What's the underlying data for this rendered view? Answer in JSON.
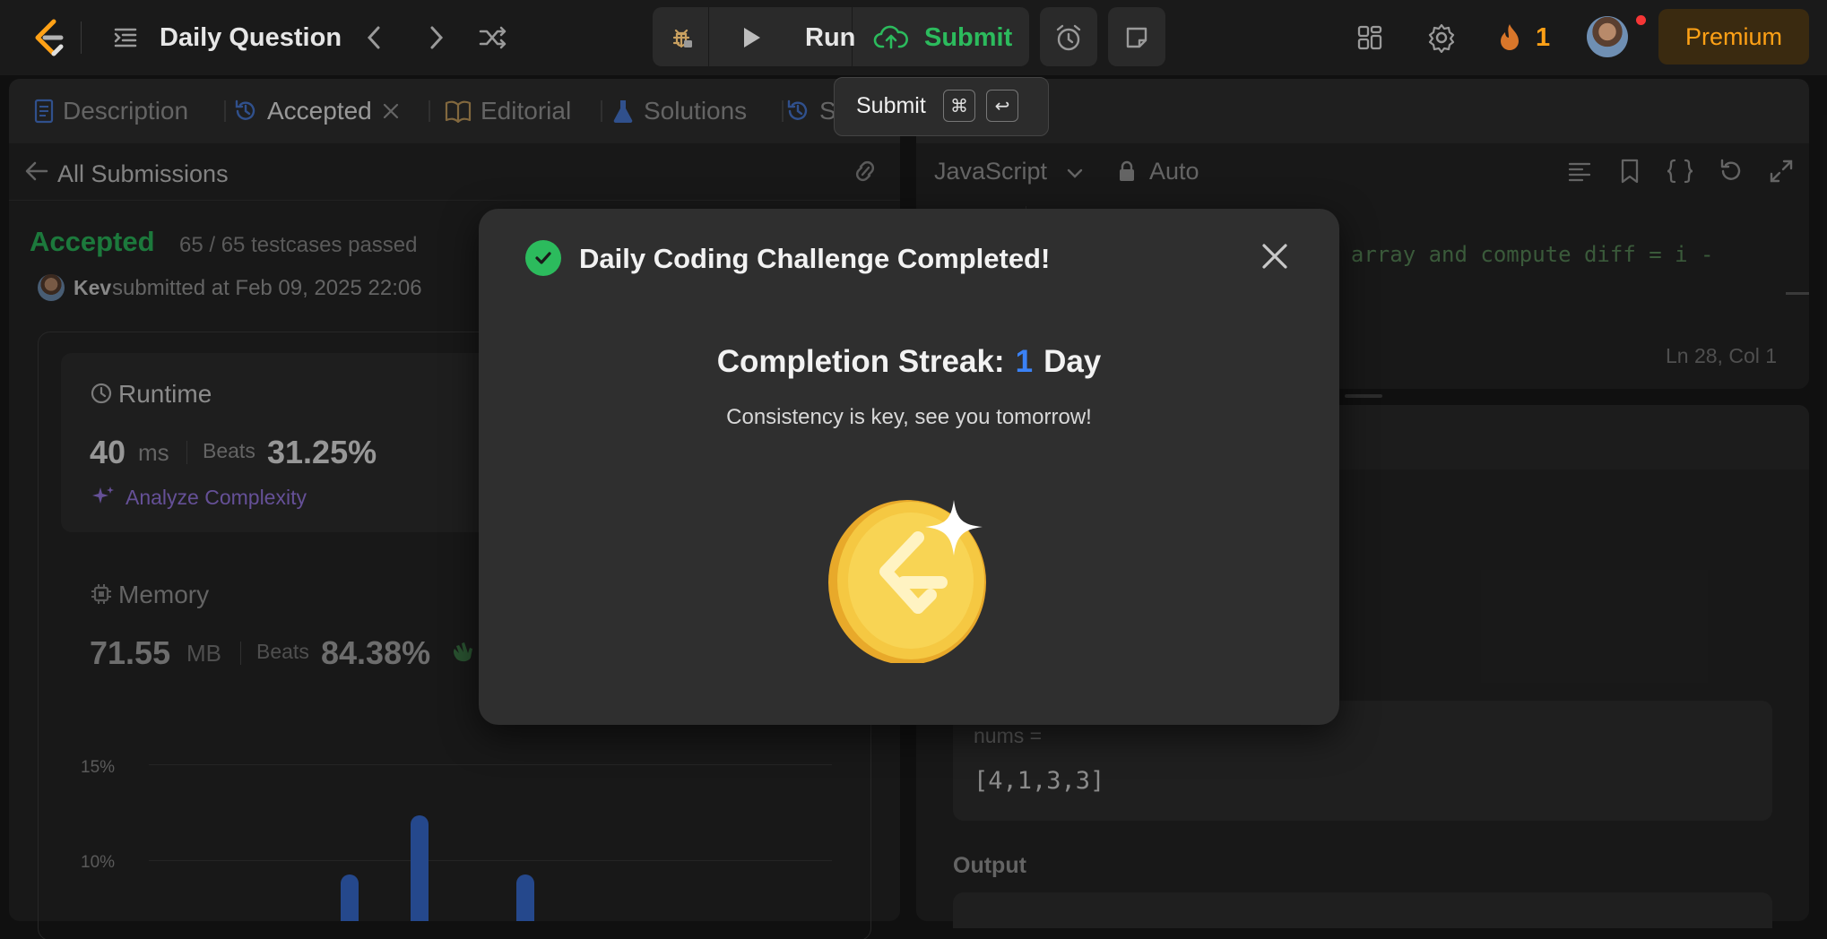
{
  "topbar": {
    "title": "Daily Question",
    "run_label": "Run",
    "submit_label": "Submit",
    "streak_count": "1",
    "premium_label": "Premium"
  },
  "tooltip": {
    "label": "Submit",
    "key1": "⌘",
    "key2": "↩"
  },
  "left_panel": {
    "tabs": [
      {
        "label": "Description"
      },
      {
        "label": "Accepted"
      },
      {
        "label": "Editorial"
      },
      {
        "label": "Solutions"
      },
      {
        "label": "S"
      }
    ],
    "back_label": "All Submissions",
    "status": "Accepted",
    "testcases": "65 / 65 testcases passed",
    "username": "Kev",
    "submitted": "submitted at Feb 09, 2025 22:06",
    "runtime": {
      "label": "Runtime",
      "value": "40",
      "unit": "ms",
      "beats_label": "Beats",
      "beats_value": "31.25%",
      "analyze_label": "Analyze Complexity"
    },
    "memory": {
      "label": "Memory",
      "value": "71.55",
      "unit": "MB",
      "beats_label": "Beats",
      "beats_value": "84.38%"
    },
    "chart_ticks": [
      "15%",
      "10%"
    ]
  },
  "editor": {
    "language": "JavaScript",
    "mode": "Auto",
    "code_line": "e array and compute diff = i -",
    "cursor": "Ln 28, Col 1"
  },
  "result": {
    "input_label": "nums =",
    "input_value": "[4,1,3,3]",
    "output_label": "Output"
  },
  "modal": {
    "title": "Daily Coding Challenge Completed!",
    "streak_prefix": "Completion Streak:",
    "streak_value": "1",
    "streak_suffix": "Day",
    "message": "Consistency is key, see you tomorrow!"
  },
  "colors": {
    "accent_green": "#2cbb5d",
    "accent_orange": "#ffa116",
    "accent_blue": "#3b82f6",
    "coin_gold": "#f5c842"
  }
}
